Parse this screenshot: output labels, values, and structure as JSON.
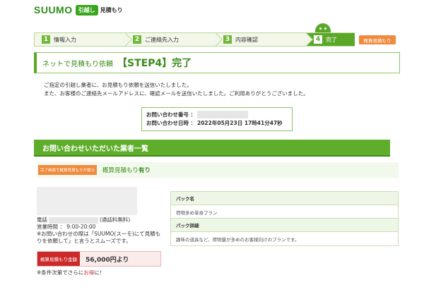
{
  "header": {
    "logo": "SUUMO",
    "badge": "引越し",
    "subtitle": "見積もり"
  },
  "steps": [
    {
      "num": "1",
      "label": "情報入力"
    },
    {
      "num": "2",
      "label": "ご連絡先入力"
    },
    {
      "num": "3",
      "label": "内容確認"
    },
    {
      "num": "4",
      "label": "完了"
    }
  ],
  "estimate_tag": "概算見積もり",
  "completion": {
    "small": "ネットで見積もり依頼",
    "big": "【STEP4】完了"
  },
  "message": {
    "line1": "ご指定の引越し業者に、お見積もり依頼を送信いたしました。",
    "line2": "また、お客様のご連絡先メールアドレスに、確認メールを送信いたしました。ご利用ありがとうございました。"
  },
  "inquiry": {
    "number_label": "お問い合わせ番号 ：",
    "datetime_label": "お問い合わせ日時 ：",
    "datetime_value": "2022年05月23日 17時41分47秒"
  },
  "section_title": "お問い合わせいただいた業者一覧",
  "estimate_row": {
    "tag": "完了画面で概算見積もりが提示",
    "label_prefix": "概算見積もり",
    "label_value": "有り"
  },
  "company": {
    "tel_label": "電話",
    "tel_note": "(通話料無料)",
    "hours": "営業時間 ： 9:00-20:00",
    "note1": "※お問い合わせの際は「SUUMO(スーモ)にて見積も",
    "note2": "りを依頼して」と言うとスムーズです。",
    "price_label": "概算見積もり金額",
    "price_value": "56,000円より",
    "price_note_prefix": "※条件次第でさらに",
    "price_note_highlight": "お得",
    "price_note_suffix": "に！"
  },
  "pack": {
    "name_header": "パック名",
    "name_value": "荷物多め単身プラン",
    "detail_header": "パック詳細",
    "detail_value": "趣味の道具など、荷物量が多めのお客様向けのプランです。"
  }
}
